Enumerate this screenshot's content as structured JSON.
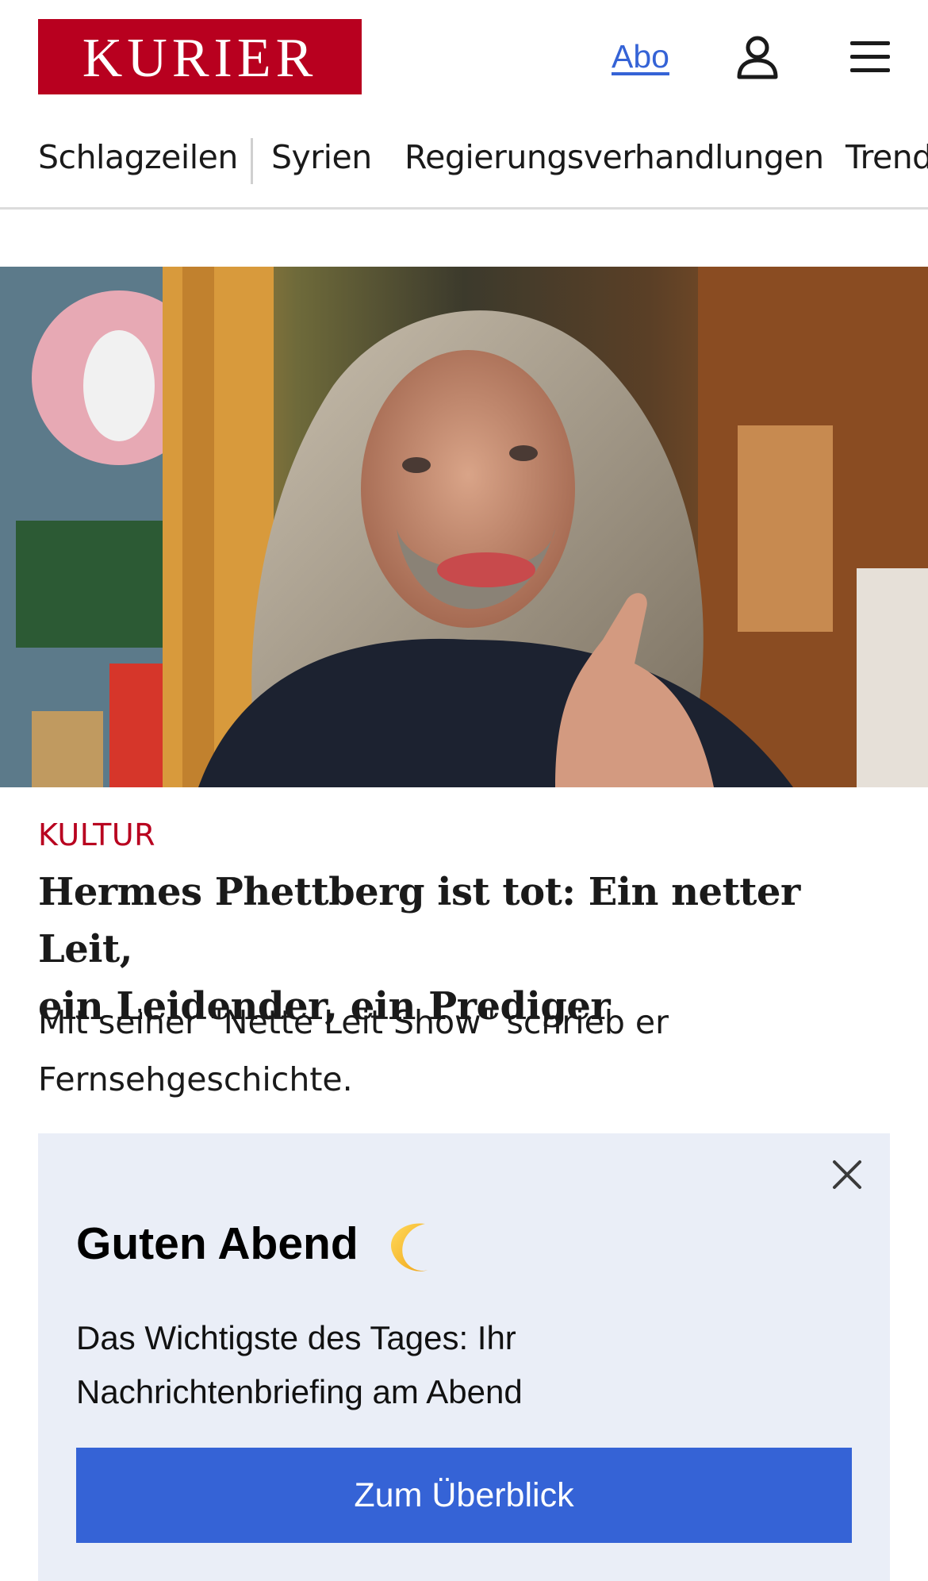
{
  "header": {
    "logo_text": "KURIER",
    "abo_label": "Abo",
    "user_icon": "user-icon",
    "menu_icon": "hamburger-menu-icon",
    "brand_color": "#b8001f",
    "link_color": "#3563d6"
  },
  "nav": {
    "items": [
      {
        "label": "Schlagzeilen"
      },
      {
        "label": "Syrien"
      },
      {
        "label": "Regierungsverhandlungen"
      },
      {
        "label": "Trend"
      }
    ]
  },
  "article": {
    "image_alt": "Porträt von Hermes Phettberg",
    "kicker": "KULTUR",
    "headline_line1": "Hermes Phettberg ist tot: Ein netter Leit,",
    "headline_line2": "ein Leidender, ein Prediger",
    "teaser_line1": "Mit seiner \"Nette Leit Show\" schrieb er",
    "teaser_line2": "Fernsehgeschichte."
  },
  "overlay": {
    "title": "Guten Abend",
    "title_icon": "moon-icon",
    "text_line1": "Das Wichtigste des Tages: Ihr",
    "text_line2": "Nachrichtenbriefing am Abend",
    "cta_label": "Zum Überblick",
    "close_icon": "close-icon",
    "background_color": "#eaeef7",
    "button_color": "#3563d6"
  }
}
